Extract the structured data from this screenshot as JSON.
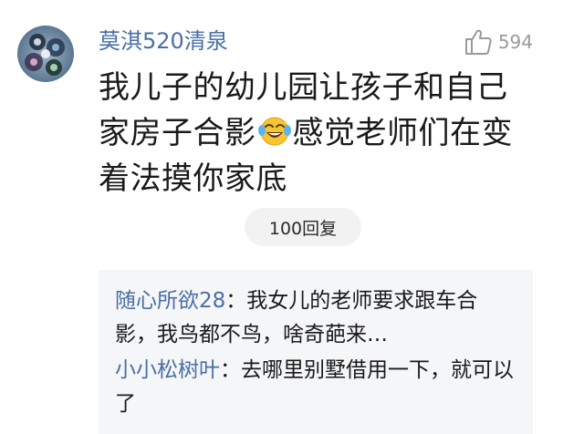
{
  "comment": {
    "username": "莫淇520清泉",
    "like_count": "594",
    "text_part1": "我儿子的幼儿园让孩子和自己家房子合影",
    "emoji": "laughing-crying-emoji",
    "text_part2": "感觉老师们在变着法摸你家底"
  },
  "replies_button": {
    "label": "100回复"
  },
  "replies": [
    {
      "user": "随心所欲28",
      "separator": "：",
      "text": "我女儿的老师要求跟车合影，我鸟都不鸟，啥奇葩来…"
    },
    {
      "user": "小小松树叶",
      "separator": "：",
      "text": "去哪里别墅借用一下，就可以了"
    }
  ],
  "colors": {
    "username": "#4a6fa5",
    "body_text": "#1a1a1a",
    "muted": "#9a9a9a",
    "reply_bg": "#f5f6f8"
  }
}
